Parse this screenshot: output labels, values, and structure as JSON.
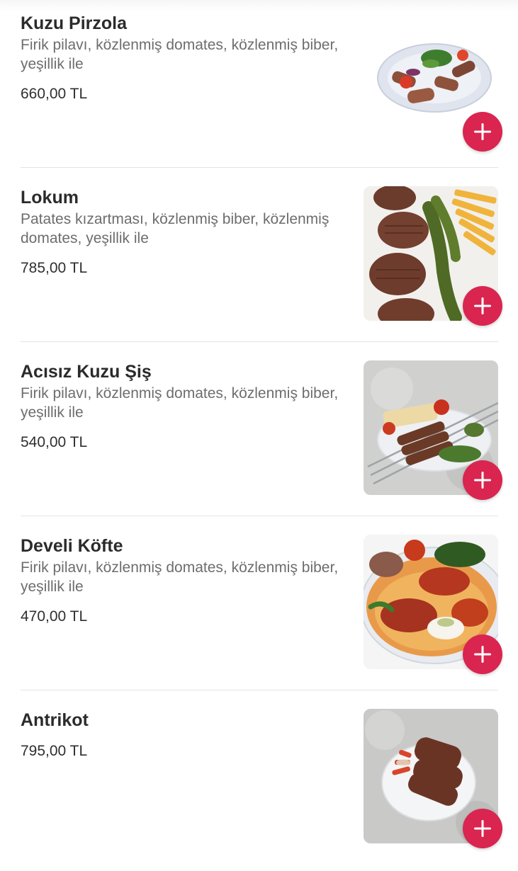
{
  "menu": {
    "items": [
      {
        "name": "Kuzu Pirzola",
        "description": "Firik pilavı, közlenmiş domates, közlenmiş biber, yeşillik ile",
        "price": "660,00 TL",
        "photo": "lamb-chops-plate"
      },
      {
        "name": "Lokum",
        "description": "Patates kızartması, közlenmiş biber, közlenmiş domates, yeşillik ile",
        "price": "785,00 TL",
        "photo": "grilled-steak-fries"
      },
      {
        "name": "Acısız Kuzu Şiş",
        "description": "Firik pilavı, közlenmiş domates, közlenmiş biber, yeşillik ile",
        "price": "540,00 TL",
        "photo": "lamb-skewers-plate"
      },
      {
        "name": "Develi Köfte",
        "description": "Firik pilavı, közlenmiş domates, közlenmiş biber, yeşillik ile",
        "price": "470,00 TL",
        "photo": "kofte-plate"
      },
      {
        "name": "Antrikot",
        "description": "",
        "price": "795,00 TL",
        "photo": "entrecote-plate"
      }
    ],
    "add_icon": "plus-icon"
  },
  "colors": {
    "accent": "#d9254f",
    "title": "#2b2b2b",
    "description": "#6d6d6d",
    "divider": "#e3e3e3"
  }
}
